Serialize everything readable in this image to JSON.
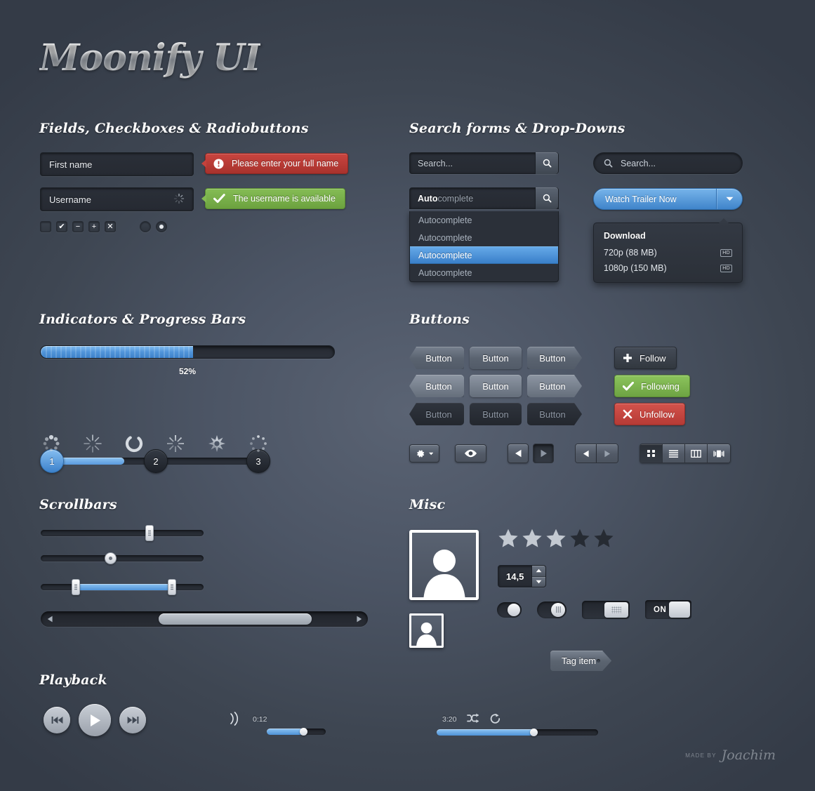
{
  "brand": "Moonify UI",
  "sections": {
    "fields": "Fields, Checkboxes & Radiobuttons",
    "search": "Search forms & Drop-Downs",
    "indicators": "Indicators & Progress Bars",
    "buttons": "Buttons",
    "scrollbars": "Scrollbars",
    "misc": "Misc",
    "playback": "Playback"
  },
  "fields": {
    "first_name": "First name",
    "username": "Username",
    "error_message": "Please enter your full name",
    "success_message": "The username is available",
    "checkboxes": [
      {
        "name": "checkbox-empty",
        "glyph": ""
      },
      {
        "name": "checkbox-checked",
        "glyph": "✔"
      },
      {
        "name": "checkbox-minus",
        "glyph": "−"
      },
      {
        "name": "checkbox-plus",
        "glyph": "+"
      },
      {
        "name": "checkbox-cross",
        "glyph": "✕"
      }
    ],
    "radios": [
      {
        "name": "radio-unselected",
        "selected": false
      },
      {
        "name": "radio-selected",
        "selected": true
      }
    ]
  },
  "search": {
    "placeholder": "Search...",
    "pill_placeholder": "Search...",
    "autocomplete_typed": "Auto",
    "autocomplete_rest": "complete",
    "autocomplete_options": [
      "Autocomplete",
      "Autocomplete",
      "Autocomplete",
      "Autocomplete"
    ],
    "autocomplete_selected_index": 2,
    "split_button_label": "Watch Trailer Now",
    "download": {
      "header": "Download",
      "options": [
        {
          "label": "720p (88 MB)",
          "badge": "HD"
        },
        {
          "label": "1080p (150 MB)",
          "badge": "HD"
        }
      ]
    }
  },
  "indicators": {
    "progress_percent": 52,
    "progress_label": "52%",
    "steps": [
      {
        "label": "1",
        "active": true
      },
      {
        "label": "2",
        "active": false
      },
      {
        "label": "3",
        "active": false
      }
    ],
    "spinners": [
      "spinner-dots-icon",
      "spinner-spokes-thin-icon",
      "spinner-arc-icon",
      "spinner-spokes-tapered-icon",
      "spinner-petals-icon",
      "spinner-dotted-ring-icon"
    ]
  },
  "buttons": {
    "grid": [
      [
        {
          "label": "Button",
          "style": "dark",
          "shape": "left"
        },
        {
          "label": "Button",
          "style": "dark",
          "shape": "mid"
        },
        {
          "label": "Button",
          "style": "dark",
          "shape": "right"
        }
      ],
      [
        {
          "label": "Button",
          "style": "light",
          "shape": "left"
        },
        {
          "label": "Button",
          "style": "light",
          "shape": "mid"
        },
        {
          "label": "Button",
          "style": "light",
          "shape": "right"
        }
      ],
      [
        {
          "label": "Button",
          "style": "darker",
          "shape": "left"
        },
        {
          "label": "Button",
          "style": "darker",
          "shape": "mid"
        },
        {
          "label": "Button",
          "style": "darker",
          "shape": "right"
        }
      ]
    ],
    "follow": "Follow",
    "following": "Following",
    "unfollow": "Unfollow",
    "toolbar_icons": [
      "gear-icon",
      "caret-down-icon",
      "eye-icon",
      "prev-arrow-icon",
      "next-arrow-icon",
      "grid-view-icon",
      "list-view-icon",
      "column-view-icon",
      "coverflow-view-icon"
    ]
  },
  "misc": {
    "rating_filled": 3,
    "rating_total": 5,
    "stepper_value": "14,5",
    "tag_label": "Tag item",
    "toggle_on_label": "ON",
    "toggles": [
      {
        "name": "toggle-round-plain",
        "on": true
      },
      {
        "name": "toggle-round-knurled",
        "on": true
      },
      {
        "name": "toggle-square-knurled",
        "on": true
      },
      {
        "name": "toggle-labeled-on",
        "on": true
      }
    ]
  },
  "playback": {
    "prev": "prev-track-icon",
    "play": "play-icon",
    "next": "next-track-icon",
    "volume_percent": 62,
    "volume_icon": "sound-waves-icon",
    "time_current": "0:12",
    "time_total": "3:20",
    "timeline_percent": 60,
    "shuffle": "shuffle-icon",
    "repeat": "repeat-icon"
  },
  "footer": {
    "made_by": "MADE BY",
    "author": "Joachim"
  },
  "colors": {
    "background": "#4c5565",
    "accent_blue": "#4f93d8",
    "success_green": "#7bb44e",
    "danger_red": "#c5423c",
    "field_dark": "#282c34"
  }
}
